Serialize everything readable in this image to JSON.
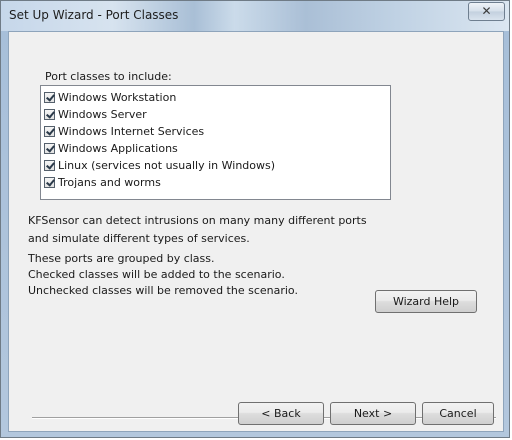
{
  "window": {
    "title": "Set Up Wizard - Port Classes",
    "close_glyph": "✕"
  },
  "ports": {
    "heading": "Port classes to include:",
    "items": [
      {
        "label": "Windows Workstation",
        "checked": true
      },
      {
        "label": "Windows Server",
        "checked": true
      },
      {
        "label": "Windows Internet Services",
        "checked": true
      },
      {
        "label": "Windows Applications",
        "checked": true
      },
      {
        "label": "Linux (services not usually in Windows)",
        "checked": true
      },
      {
        "label": "Trojans and worms",
        "checked": true
      }
    ]
  },
  "description": {
    "line1": "KFSensor can detect intrusions on many many different ports",
    "line2": "and simulate different types of services.",
    "line3": "These ports are grouped by class.",
    "line4": "Checked classes will be added to the scenario.",
    "line5": "Unchecked classes will be removed the scenario."
  },
  "buttons": {
    "wizard_help": "Wizard Help",
    "back": "< Back",
    "next": "Next >",
    "cancel": "Cancel"
  }
}
